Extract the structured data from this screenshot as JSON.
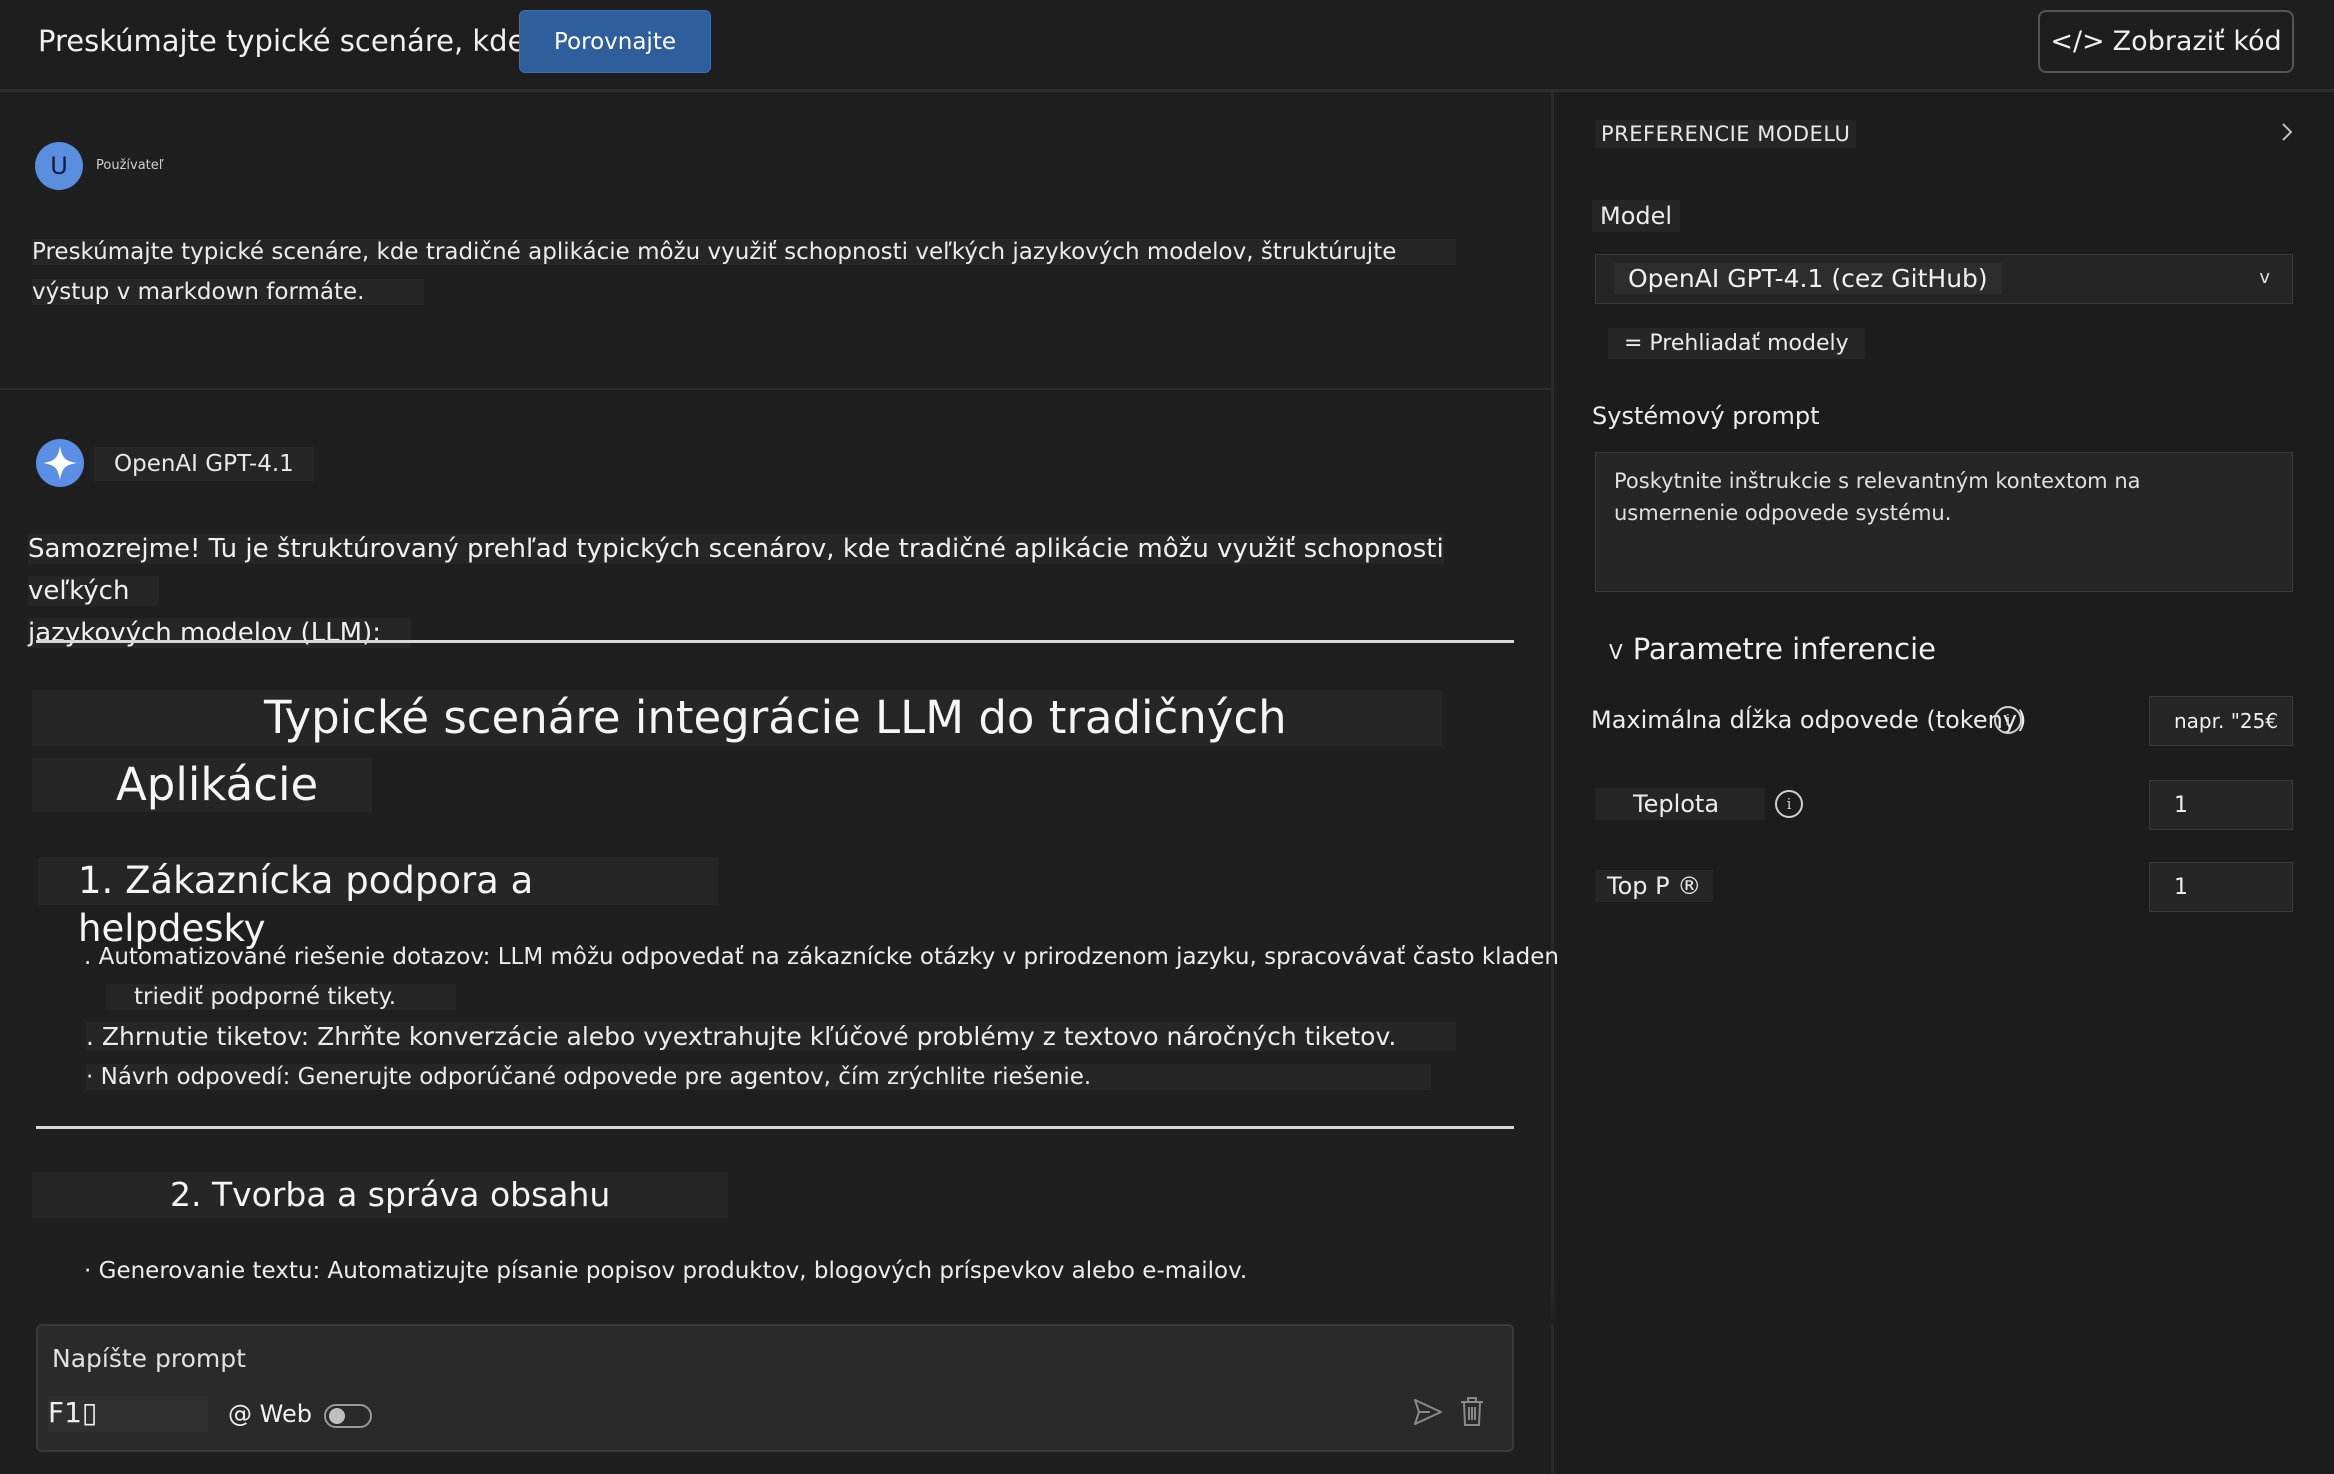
{
  "header": {
    "title": "Preskúmajte typické scenáre, kde ...",
    "compare_label": "Porovnajte",
    "code_label": "Zobraziť kód",
    "code_icon": "</>"
  },
  "user_message": {
    "avatar_letter": "U",
    "author": "Používateľ",
    "line1": "Preskúmajte typické scenáre, kde tradičné aplikácie môžu využiť schopnosti veľkých jazykových modelov, štruktúrujte",
    "line2": "výstup v markdown formáte."
  },
  "ai_message": {
    "author": "OpenAI GPT-4.1",
    "intro_line1": "Samozrejme! Tu je štruktúrovaný prehľad typických scenárov, kde tradičné aplikácie môžu využiť schopnosti veľkých",
    "intro_line2": "jazykových modelov (LLM):",
    "heading_line1": "Typické scenáre integrácie LLM do tradičných",
    "heading_line2": "Aplikácie",
    "section1": {
      "title": "1. Zákaznícka podpora a helpdesky",
      "items": [
        ". Automatizované riešenie dotazov: LLM môžu odpovedať na zákaznícke otázky v prirodzenom jazyku, spracovávať často kladené otázky a",
        "triediť podporné tikety.",
        ". Zhrnutie tiketov: Zhrňte konverzácie alebo vyextrahujte kľúčové problémy z textovo náročných tiketov.",
        "· Návrh odpovedí: Generujte odporúčané odpovede pre agentov, čím zrýchlite riešenie."
      ]
    },
    "section2": {
      "title": "2. Tvorba a správa obsahu",
      "items": [
        "· Generovanie textu: Automatizujte písanie popisov produktov, blogových príspevkov alebo e-mailov."
      ]
    }
  },
  "composer": {
    "placeholder": "Napíšte prompt",
    "shortcut": "F1▯",
    "web_label": "@ Web",
    "web_enabled": false
  },
  "panel": {
    "title": "PREFERENCIE MODELU",
    "model_label": "Model",
    "model_value": "OpenAI GPT-4.1 (cez GitHub)",
    "model_arrow": "v",
    "browse_label": "= Prehliadať modely",
    "system_prompt_label": "Systémový prompt",
    "system_prompt_placeholder": "Poskytnite inštrukcie s relevantným kontextom na usmernenie odpovede systému.",
    "inference_caret": "V",
    "inference_label": "Parametre inferencie",
    "max_tokens_label": "Maximálna dĺžka odpovede (tokeny)",
    "max_tokens_value": "napr. \"25€",
    "temperature_label": "Teplota",
    "temperature_value": "1",
    "top_p_label": "Top P ®",
    "top_p_value": "1",
    "info_glyph": "i"
  },
  "colors": {
    "accent": "#2f5e9c",
    "background": "#1f1f1f",
    "panel": "#1c1c1c"
  }
}
